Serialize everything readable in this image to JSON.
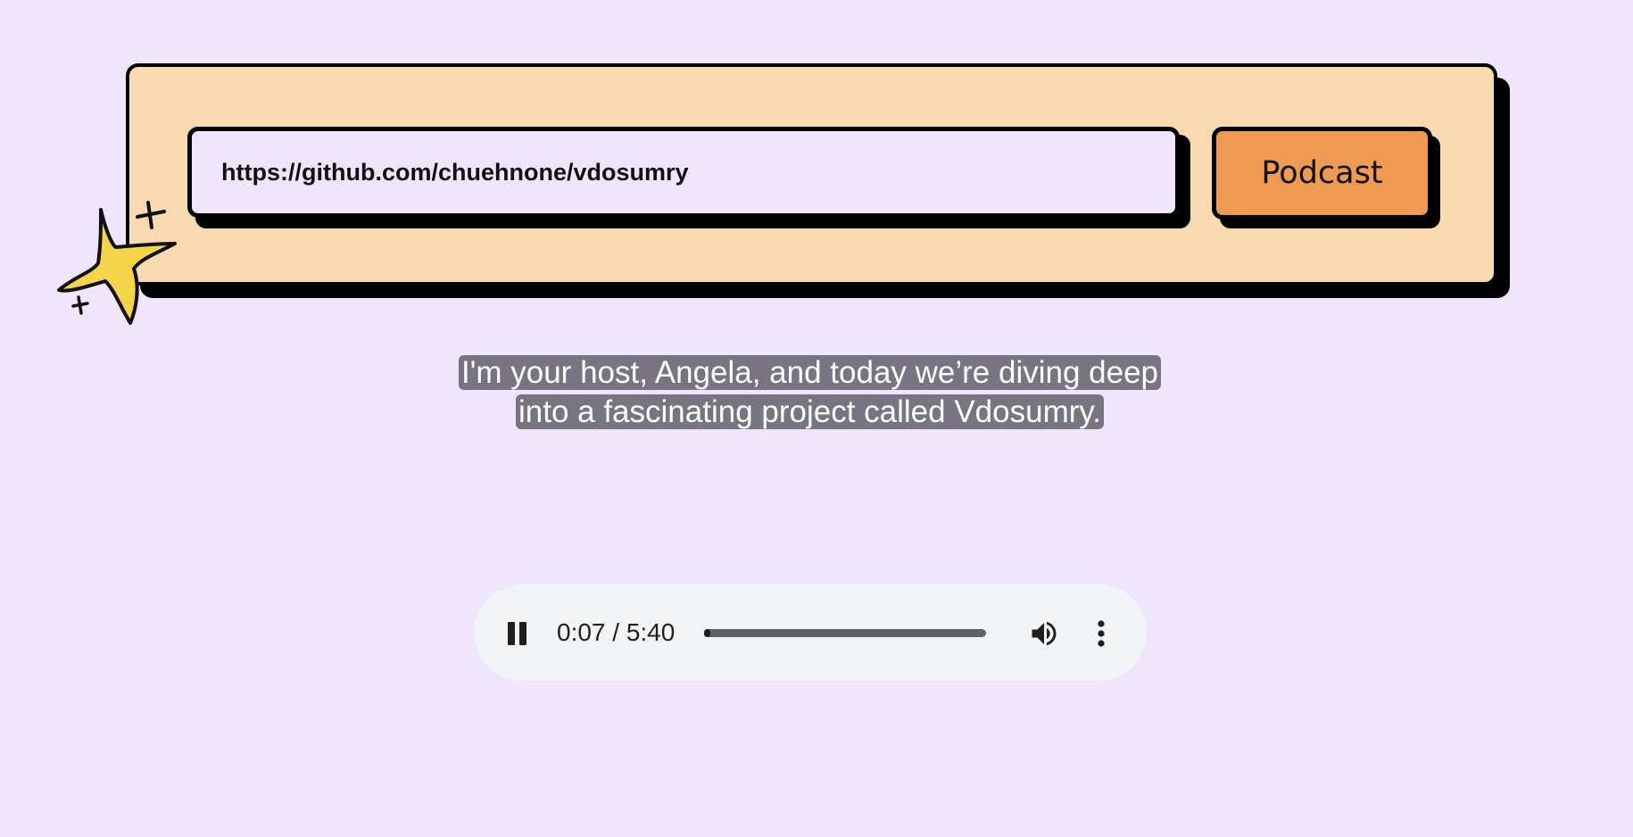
{
  "form": {
    "url_value": "https://github.com/chuehnone/vdosumry",
    "submit_label": "Podcast"
  },
  "caption": {
    "text": "I'm your host, Angela, and today we’re diving deep into a fascinating project called Vdosumry."
  },
  "player": {
    "current_time": "0:07",
    "duration": "5:40",
    "time_display": "0:07 / 5:40",
    "progress_fraction": 0.021,
    "state": "playing",
    "icons": {
      "play_toggle": "pause-icon",
      "volume": "volume-icon",
      "menu": "more-vert-icon"
    }
  },
  "decoration": {
    "icon": "sparkle-star-icon",
    "star_color": "#f6d44a"
  },
  "colors": {
    "page_background": "#efe6fd",
    "card_background": "#f8d9b0",
    "button_background": "#ee9a52",
    "caption_highlight": "#797481"
  }
}
